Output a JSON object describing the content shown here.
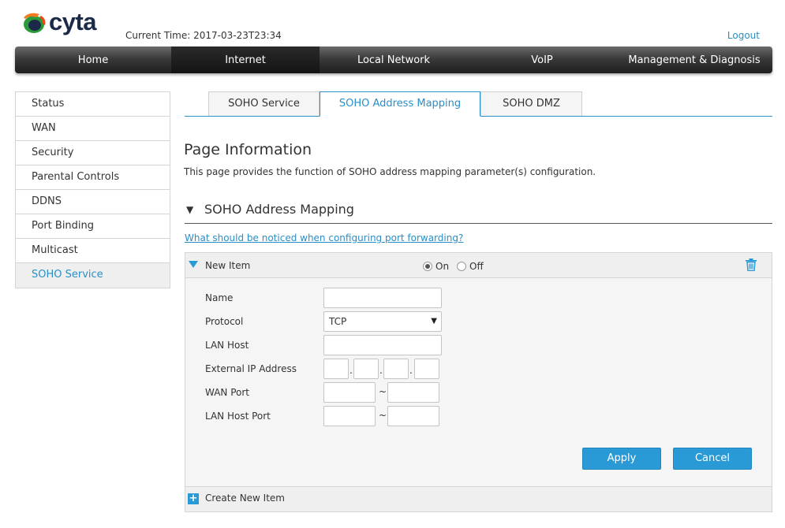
{
  "header": {
    "logo_text": "cyta",
    "current_time_label": "Current Time:",
    "current_time_value": "2017-03-23T23:34",
    "logout_label": "Logout"
  },
  "topnav": {
    "items": [
      "Home",
      "Internet",
      "Local Network",
      "VoIP",
      "Management & Diagnosis"
    ],
    "active": "Internet"
  },
  "sidebar": {
    "items": [
      "Status",
      "WAN",
      "Security",
      "Parental Controls",
      "DDNS",
      "Port Binding",
      "Multicast",
      "SOHO Service"
    ],
    "active": "SOHO Service"
  },
  "tabs": {
    "items": [
      "SOHO Service",
      "SOHO Address Mapping",
      "SOHO DMZ"
    ],
    "active": "SOHO Address Mapping"
  },
  "page_info": {
    "title": "Page Information",
    "description": "This page provides the function of SOHO address mapping parameter(s) configuration."
  },
  "section": {
    "title": "SOHO Address Mapping",
    "help_link": "What should be noticed when configuring port forwarding?"
  },
  "item": {
    "title": "New Item",
    "on_label": "On",
    "off_label": "Off",
    "enabled": "On"
  },
  "form": {
    "name_label": "Name",
    "name_value": "",
    "protocol_label": "Protocol",
    "protocol_value": "TCP",
    "lan_host_label": "LAN Host",
    "lan_host_value": "",
    "external_ip_label": "External IP Address",
    "wan_port_label": "WAN Port",
    "lan_host_port_label": "LAN Host Port",
    "ip_separator": ".",
    "range_separator": "~"
  },
  "buttons": {
    "apply": "Apply",
    "cancel": "Cancel"
  },
  "footer": {
    "create_label": "Create New Item"
  },
  "colors": {
    "accent": "#2a8fc7",
    "button": "#2a9ad6",
    "nav_dark": "#1e1e1e"
  }
}
